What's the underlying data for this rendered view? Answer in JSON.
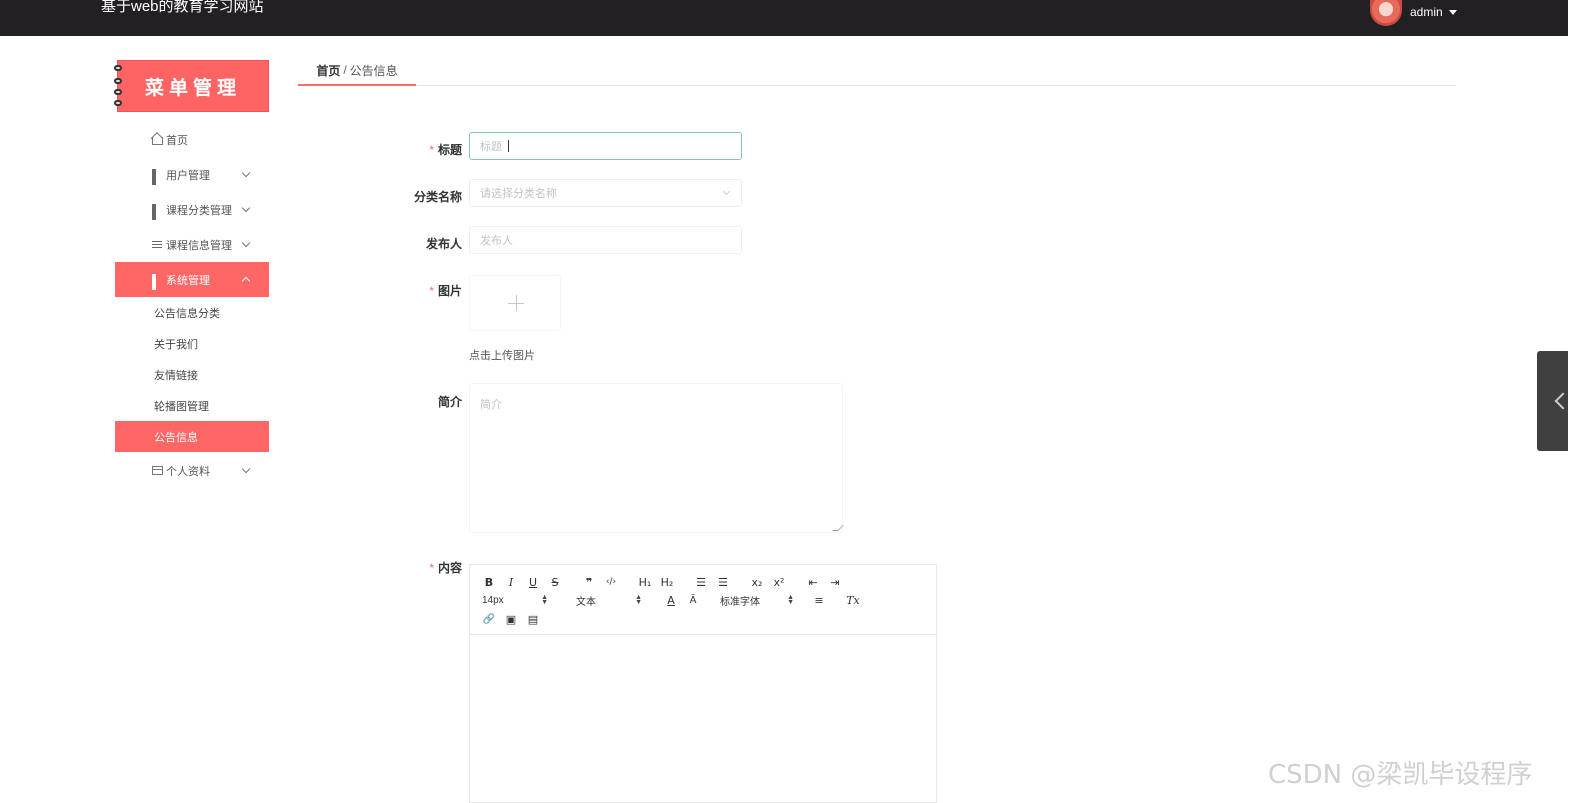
{
  "header": {
    "site_title": "基于web的教育学习网站",
    "username": "admin",
    "avatar_icon": "avatar"
  },
  "sidebar": {
    "logo_text": "菜单管理",
    "items": [
      {
        "label": "首页",
        "icon": "home-icon"
      },
      {
        "label": "用户管理",
        "icon": "grid-icon"
      },
      {
        "label": "课程分类管理",
        "icon": "grid-icon"
      },
      {
        "label": "课程信息管理",
        "icon": "list-icon"
      },
      {
        "label": "系统管理",
        "icon": "grid-icon",
        "active": true
      },
      {
        "label": "个人资料",
        "icon": "card-icon"
      }
    ],
    "sub_items": [
      {
        "label": "公告信息分类"
      },
      {
        "label": "关于我们"
      },
      {
        "label": "友情链接"
      },
      {
        "label": "轮播图管理"
      },
      {
        "label": "公告信息",
        "active": true
      }
    ]
  },
  "breadcrumb": {
    "home": "首页",
    "separator": "/",
    "current": "公告信息"
  },
  "form": {
    "required_mark": "*",
    "title": {
      "label": "标题",
      "placeholder": "标题"
    },
    "category": {
      "label": "分类名称",
      "placeholder": "请选择分类名称"
    },
    "publisher": {
      "label": "发布人",
      "placeholder": "发布人"
    },
    "image": {
      "label": "图片",
      "tip": "点击上传图片"
    },
    "intro": {
      "label": "简介",
      "placeholder": "简介"
    },
    "content": {
      "label": "内容"
    }
  },
  "editor": {
    "row1": {
      "bold": "B",
      "italic": "I",
      "underline": "U",
      "strike": "S",
      "quote": "❞",
      "code": "‹/›",
      "h1": "H₁",
      "h2": "H₂",
      "ordered": "☰",
      "bullet": "☰",
      "sub": "x₂",
      "sup": "x²",
      "outdent": "⇤",
      "indent": "⇥"
    },
    "row2": {
      "size": "14px",
      "header": "文本",
      "color": "A",
      "background": "Ā",
      "font": "标准字体",
      "align": "≡",
      "clean": "Tx"
    },
    "row3": {
      "link": "🔗",
      "image": "▣",
      "video": "▤"
    }
  },
  "watermark": "CSDN @梁凯毕设程序",
  "colors": {
    "accent": "#ff6767",
    "topbar": "#232023",
    "required": "#f56c6c"
  }
}
